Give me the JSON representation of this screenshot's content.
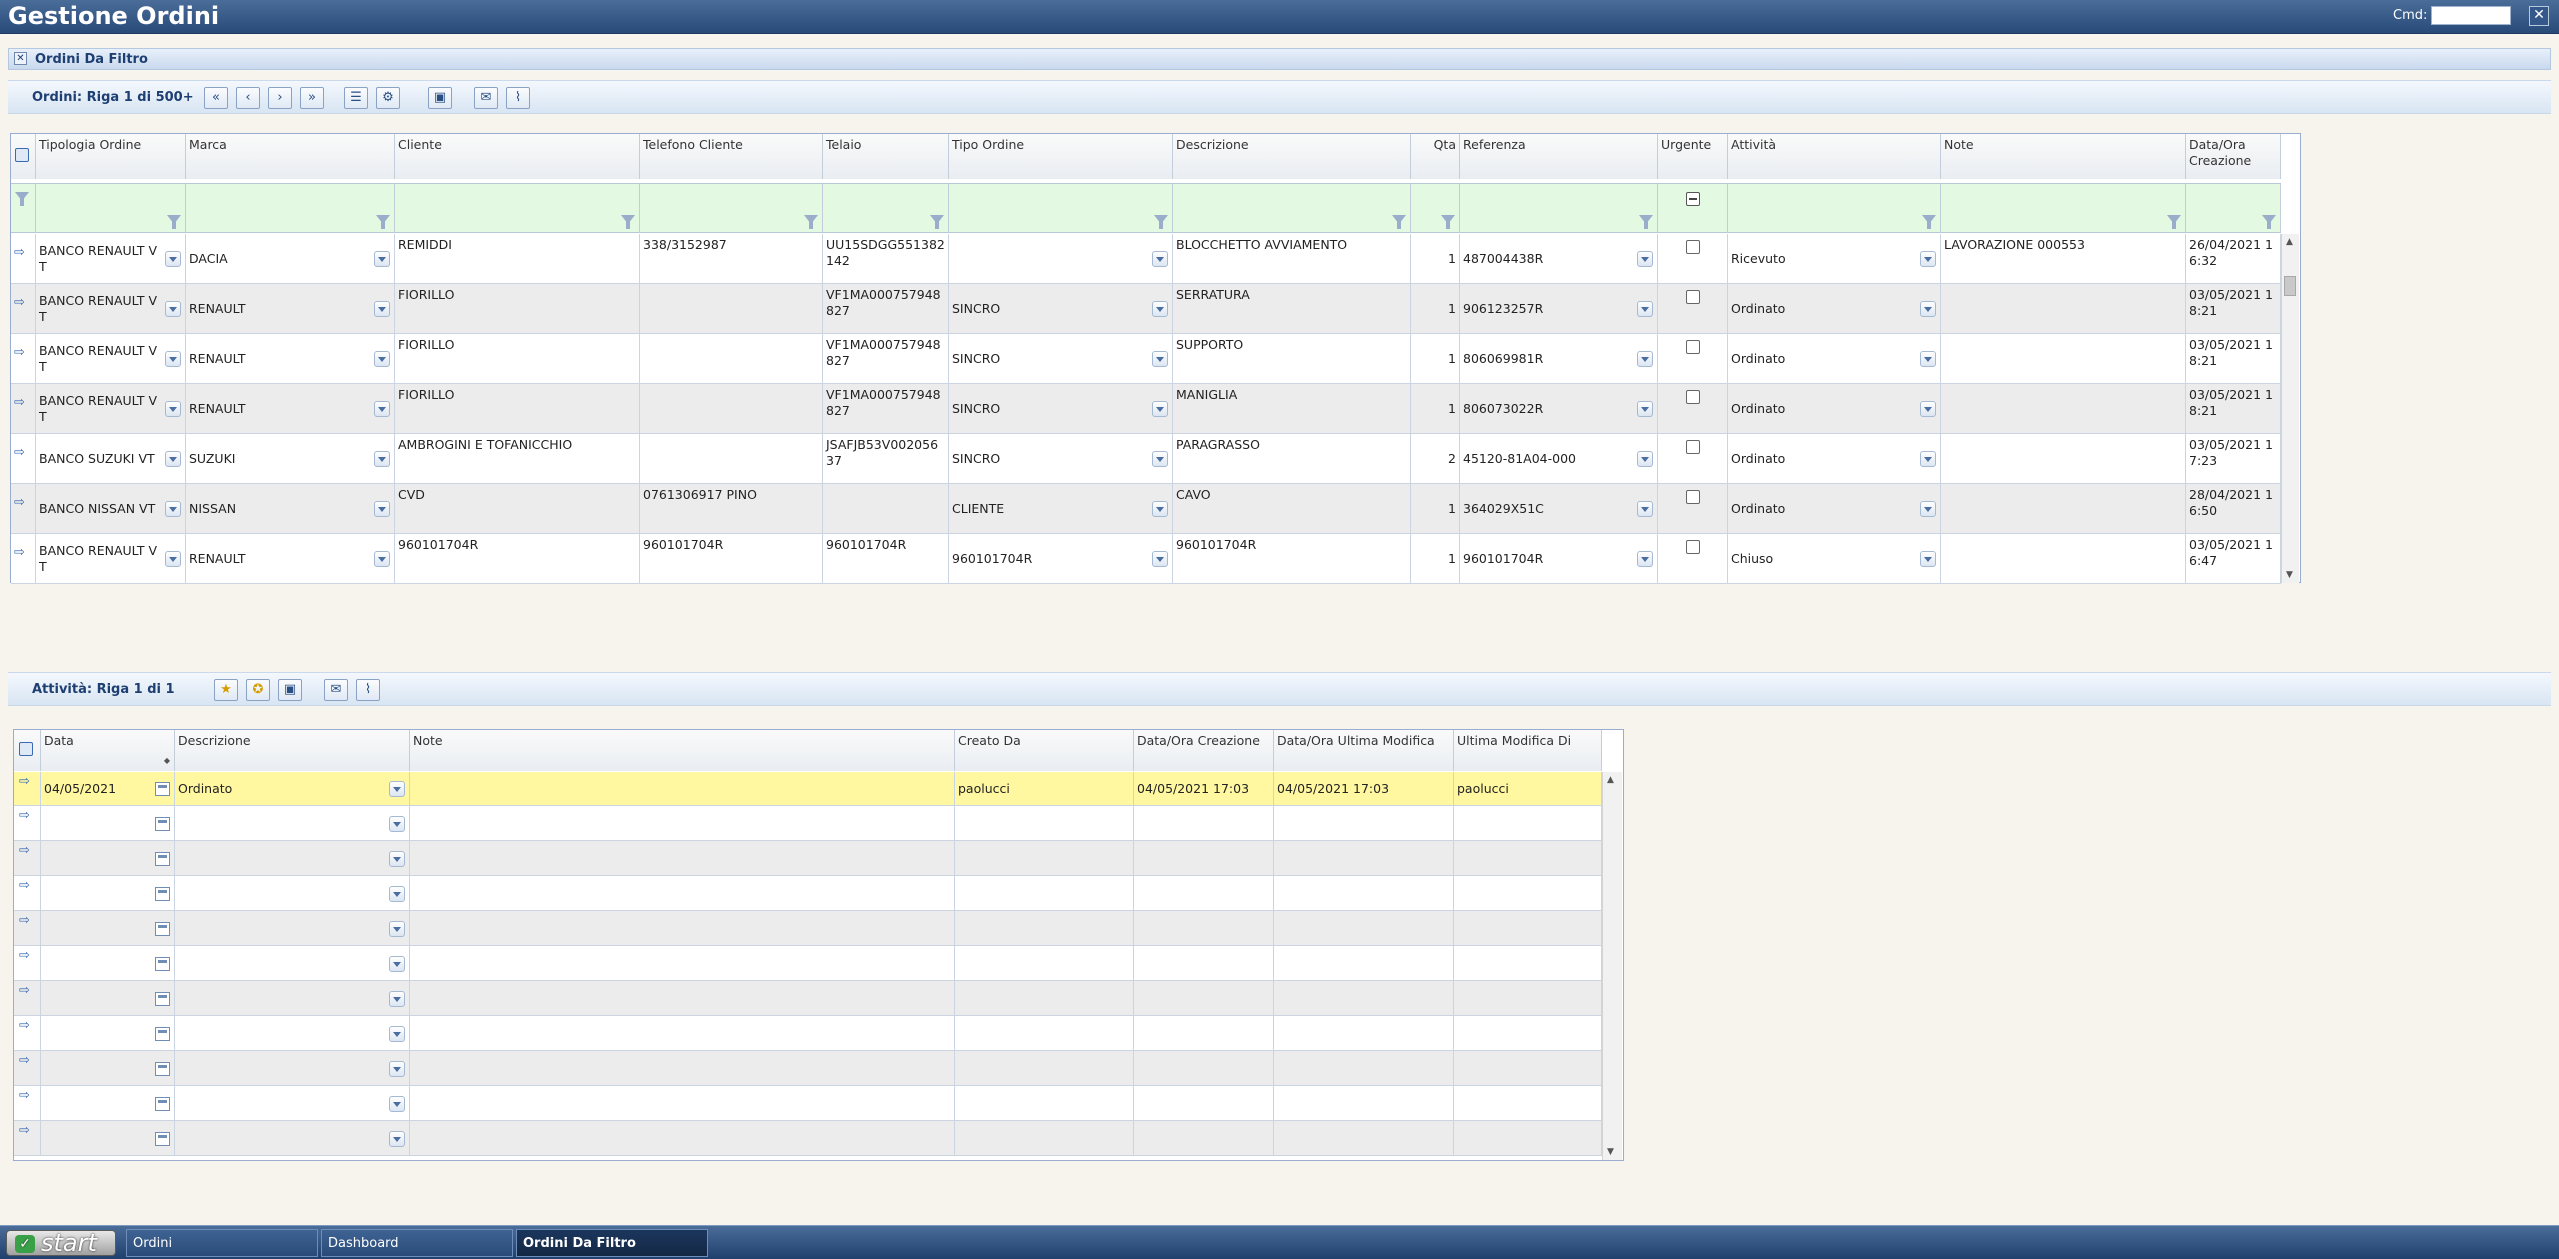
{
  "app": {
    "title": "Gestione Ordini",
    "cmd_label": "Cmd:",
    "cmd_value": "",
    "close_icon": "x-icon"
  },
  "panel": {
    "title": "Ordini Da Filtro"
  },
  "orders_toolbar": {
    "label": "Ordini: Riga 1 di 500+"
  },
  "orders_grid": {
    "columns": [
      "Tipologia Ordine",
      "Marca",
      "Cliente",
      "Telefono Cliente",
      "Telaio",
      "Tipo Ordine",
      "Descrizione",
      "Qta",
      "Referenza",
      "Urgente",
      "Attività",
      "Note",
      "Data/Ora Creazione"
    ],
    "rows": [
      {
        "tipologia": "BANCO RENAULT VT",
        "marca": "DACIA",
        "cliente": "REMIDDI",
        "telefono": "338/3152987",
        "telaio": "UU15SDGG551382142",
        "tipo": "",
        "descrizione": "BLOCCHETTO AVVIAMENTO",
        "qta": "1",
        "referenza": "487004438R",
        "urgente": false,
        "attivita": "Ricevuto",
        "note": "LAVORAZIONE 000553",
        "data": "26/04/2021 16:32"
      },
      {
        "tipologia": "BANCO RENAULT VT",
        "marca": "RENAULT",
        "cliente": "FIORILLO",
        "telefono": "",
        "telaio": "VF1MA000757948827",
        "tipo": "SINCRO",
        "descrizione": "SERRATURA",
        "qta": "1",
        "referenza": "906123257R",
        "urgente": false,
        "attivita": "Ordinato",
        "note": "",
        "data": "03/05/2021 18:21"
      },
      {
        "tipologia": "BANCO RENAULT VT",
        "marca": "RENAULT",
        "cliente": "FIORILLO",
        "telefono": "",
        "telaio": "VF1MA000757948827",
        "tipo": "SINCRO",
        "descrizione": "SUPPORTO",
        "qta": "1",
        "referenza": "806069981R",
        "urgente": false,
        "attivita": "Ordinato",
        "note": "",
        "data": "03/05/2021 18:21"
      },
      {
        "tipologia": "BANCO RENAULT VT",
        "marca": "RENAULT",
        "cliente": "FIORILLO",
        "telefono": "",
        "telaio": "VF1MA000757948827",
        "tipo": "SINCRO",
        "descrizione": "MANIGLIA",
        "qta": "1",
        "referenza": "806073022R",
        "urgente": false,
        "attivita": "Ordinato",
        "note": "",
        "data": "03/05/2021 18:21"
      },
      {
        "tipologia": "BANCO SUZUKI VT",
        "marca": "SUZUKI",
        "cliente": "AMBROGINI E TOFANICCHIO",
        "telefono": "",
        "telaio": "JSAFJB53V00205637",
        "tipo": "SINCRO",
        "descrizione": "PARAGRASSO",
        "qta": "2",
        "referenza": "45120-81A04-000",
        "urgente": false,
        "attivita": "Ordinato",
        "note": "",
        "data": "03/05/2021 17:23"
      },
      {
        "tipologia": "BANCO NISSAN VT",
        "marca": "NISSAN",
        "cliente": "CVD",
        "telefono": "0761306917 PINO",
        "telaio": "",
        "tipo": "CLIENTE",
        "descrizione": "CAVO",
        "qta": "1",
        "referenza": "364029X51C",
        "urgente": false,
        "attivita": "Ordinato",
        "note": "",
        "data": "28/04/2021 16:50"
      },
      {
        "tipologia": "BANCO RENAULT VT",
        "marca": "RENAULT",
        "cliente": "960101704R",
        "telefono": "960101704R",
        "telaio": "960101704R",
        "tipo": "960101704R",
        "descrizione": "960101704R",
        "qta": "1",
        "referenza": "960101704R",
        "urgente": false,
        "attivita": "Chiuso",
        "note": "",
        "data": "03/05/2021 16:47"
      }
    ]
  },
  "activities_toolbar": {
    "label": "Attività: Riga 1 di 1"
  },
  "activities_grid": {
    "columns": [
      "Data",
      "Descrizione",
      "Note",
      "Creato Da",
      "Data/Ora Creazione",
      "Data/Ora Ultima Modifica",
      "Ultima Modifica Di"
    ],
    "rows": [
      {
        "data": "04/05/2021",
        "descrizione": "Ordinato",
        "note": "",
        "creato_da": "paolucci",
        "creazione": "04/05/2021 17:03",
        "modifica": "04/05/2021 17:03",
        "modifica_di": "paolucci"
      }
    ],
    "empty_rows": 10
  },
  "taskbar": {
    "start_label": "start",
    "tasks": [
      "Ordini",
      "Dashboard",
      "Ordini Da Filtro"
    ],
    "active_task": "Ordini Da Filtro"
  }
}
